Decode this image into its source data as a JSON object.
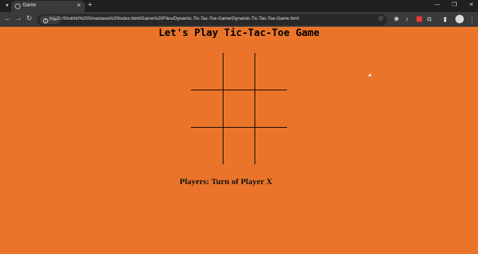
{
  "browser": {
    "tab_title": "Game",
    "url_scheme_label": "File",
    "url": "D:/Shobhit%20Srivastava%20Index.html/Game%20Files/Dynamic-Tic-Tac-Toe-Game/Dynamic-Tic-Tac-Toe-Game.html"
  },
  "page": {
    "heading": "Let's Play Tic-Tac-Toe Game",
    "status": "Players: Turn of Player X",
    "board_cells": [
      "",
      "",
      "",
      "",
      "",
      "",
      "",
      "",
      ""
    ]
  },
  "colors": {
    "page_background": "#ea752a",
    "board_lines": "#000000"
  }
}
